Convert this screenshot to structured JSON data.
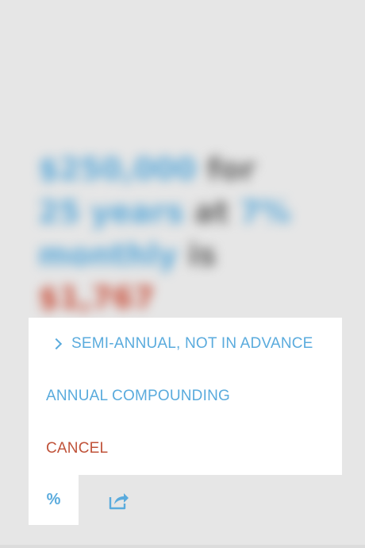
{
  "background_summary": {
    "line1_blue": "$250,000",
    "line1_grey": "for",
    "line2_blue": "25 years",
    "line2_grey": "at",
    "line2_blue2": "7%",
    "line3_blue": "monthly",
    "line3_grey": "is",
    "line3_red": "$1,767"
  },
  "menu": {
    "items": [
      {
        "label": "SEMI-ANNUAL, NOT IN ADVANCE",
        "selected": true
      },
      {
        "label": "ANNUAL COMPOUNDING",
        "selected": false
      }
    ],
    "cancel_label": "CANCEL"
  },
  "toolbar": {
    "percent_label": "%",
    "share_icon": "share-icon"
  },
  "colors": {
    "accent": "#5aabdd",
    "cancel": "#c0533a",
    "background": "#e6e6e6"
  }
}
